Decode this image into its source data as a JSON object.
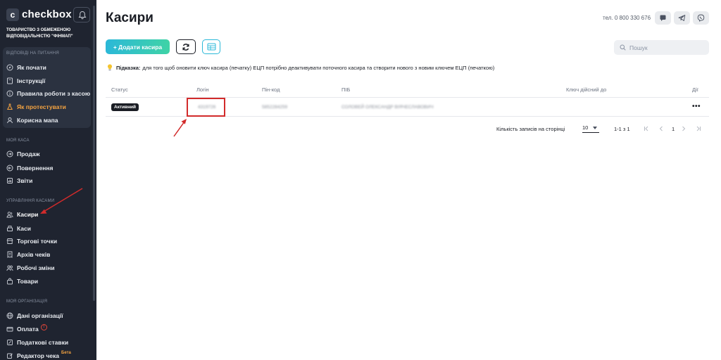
{
  "brand": {
    "logo_letter": "c",
    "name": "checkbox"
  },
  "org_name": "ТОВАРИСТВО З ОБМЕЖЕНОЮ ВІДПОВІДАЛЬНІСТЮ \"ФІНМАП\"",
  "sidebar": {
    "help_section": {
      "title": "ВІДПОВІДІ НА ПИТАННЯ",
      "items": [
        {
          "label": "Як почати",
          "icon": "compass-icon"
        },
        {
          "label": "Інструкції",
          "icon": "book-icon"
        },
        {
          "label": "Правила роботи з касою",
          "icon": "info-icon"
        },
        {
          "label": "Як протестувати",
          "icon": "flask-icon",
          "highlight": "#f4a340"
        },
        {
          "label": "Корисна мапа",
          "icon": "map-icon"
        }
      ]
    },
    "kasa_section": {
      "title": "МОЯ КАСА",
      "items": [
        {
          "label": "Продаж",
          "icon": "arrow-right-circle-icon"
        },
        {
          "label": "Повернення",
          "icon": "arrow-left-circle-icon"
        },
        {
          "label": "Звіти",
          "icon": "report-icon"
        }
      ]
    },
    "manage_section": {
      "title": "УПРАВЛІННЯ КАСАМИ",
      "items": [
        {
          "label": "Касири",
          "icon": "users-icon",
          "active": true
        },
        {
          "label": "Каси",
          "icon": "register-icon"
        },
        {
          "label": "Торгові точки",
          "icon": "store-icon"
        },
        {
          "label": "Архів чеків",
          "icon": "receipt-icon"
        },
        {
          "label": "Робочі зміни",
          "icon": "people-icon"
        },
        {
          "label": "Товари",
          "icon": "bag-icon"
        }
      ]
    },
    "org_section": {
      "title": "МОЯ ОРГАНІЗАЦІЯ",
      "items": [
        {
          "label": "Дані організації",
          "icon": "globe-icon"
        },
        {
          "label": "Оплата",
          "icon": "card-icon",
          "alert": "!"
        },
        {
          "label": "Податкові ставки",
          "icon": "tax-icon"
        },
        {
          "label": "Редактор чека",
          "icon": "edit-icon",
          "badge": "Бета"
        }
      ]
    }
  },
  "header": {
    "title": "Касири",
    "phone": "тел. 0 800 330 676",
    "icons": [
      "chat-icon",
      "telegram-icon",
      "viber-icon"
    ]
  },
  "toolbar": {
    "add_label": "+ Додати касира",
    "search_placeholder": "Пошук"
  },
  "hint": {
    "label": "Підказка:",
    "text": "для того щоб оновити ключ касира (печатку) ЕЦП потрібно деактивувати поточного касира та створити нового з новим ключем ЕЦП (печаткою)"
  },
  "table": {
    "columns": [
      "Статус",
      "Логін",
      "Пін-код",
      "ПІБ",
      "Ключ дійсний до",
      "Дії"
    ],
    "rows": [
      {
        "status": "Активний",
        "login": "4319726",
        "pin": "5852284259",
        "name": "СОЛОВЕЙ ОЛЕКСАНДР ВІЯЧЕСЛАВОВИЧ",
        "key_valid": "",
        "actions": "•••"
      }
    ]
  },
  "pagination": {
    "per_page_label": "Кількість записів на сторінці",
    "per_page_value": "10",
    "range": "1-1 з 1",
    "current_page": "1"
  },
  "colors": {
    "sidebar_bg": "#1f2430",
    "accent_teal": "#2bb8d8",
    "accent_orange": "#f4a340",
    "annotation_red": "#d22b2b"
  }
}
